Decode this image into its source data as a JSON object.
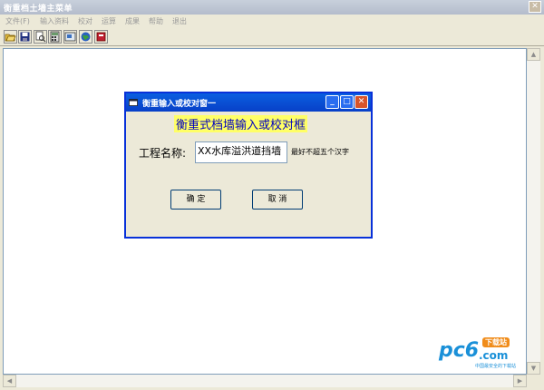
{
  "main_window": {
    "title": "衡重档土墙主菜单",
    "close_glyph": "✕"
  },
  "menu": {
    "items": [
      "文件(F)",
      "输入资料",
      "校对",
      "运算",
      "成果",
      "帮助",
      "退出"
    ]
  },
  "toolbar": {
    "buttons": [
      "open-folder-icon",
      "save-icon",
      "print-preview-icon",
      "calculator-icon",
      "view-icon",
      "globe-icon",
      "book-icon"
    ]
  },
  "dialog": {
    "title": "衡重输入或校对窗一",
    "heading": "衡重式档墙输入或校对框",
    "field_label": "工程名称:",
    "field_value": "XX水库溢洪道挡墙",
    "hint": "最好不超五个汉字",
    "ok_label": "确  定",
    "cancel_label": "取  消",
    "min_glyph": "_",
    "max_glyph": "□",
    "close_glyph": "✕"
  },
  "watermark": {
    "logo": "pc6",
    "suffix": ".com",
    "badge": "下载站",
    "tagline": "中国最安全的下载站"
  },
  "colors": {
    "dialog_title": "#0840c8",
    "heading_bg": "#ffff66",
    "heading_fg": "#0000c0",
    "watermark_blue": "#1a90d8",
    "watermark_orange": "#f08c1a"
  }
}
